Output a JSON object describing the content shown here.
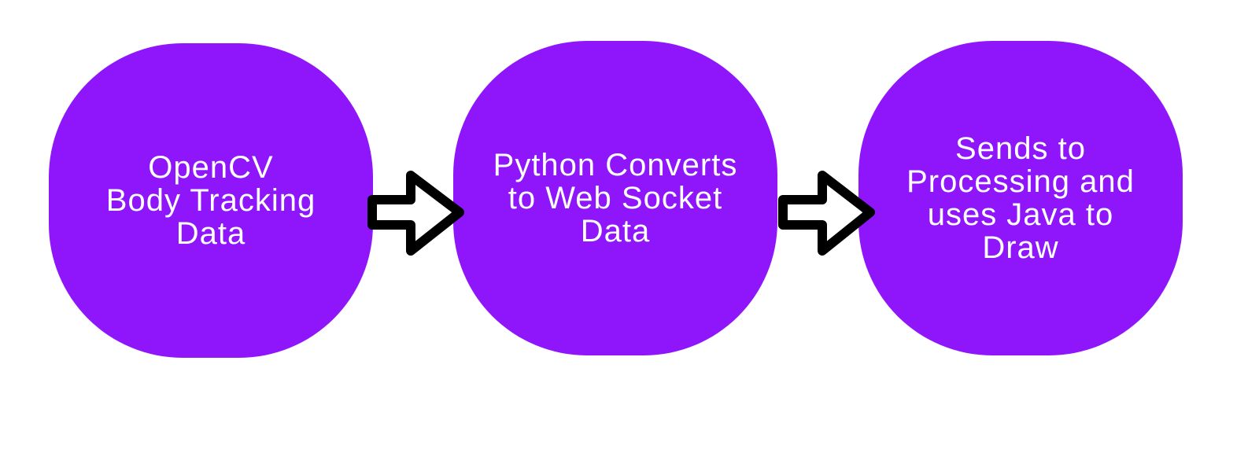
{
  "colors": {
    "box": "#8f16fb",
    "text": "#ffffff",
    "arrow_stroke": "#000000",
    "arrow_fill": "#ffffff"
  },
  "steps": [
    {
      "lines": [
        "OpenCV",
        "Body Tracking",
        "Data"
      ]
    },
    {
      "lines": [
        "Python Converts",
        "to Web Socket",
        "Data"
      ]
    },
    {
      "lines": [
        "Sends to",
        "Processing and",
        "uses Java to",
        "Draw"
      ]
    }
  ]
}
